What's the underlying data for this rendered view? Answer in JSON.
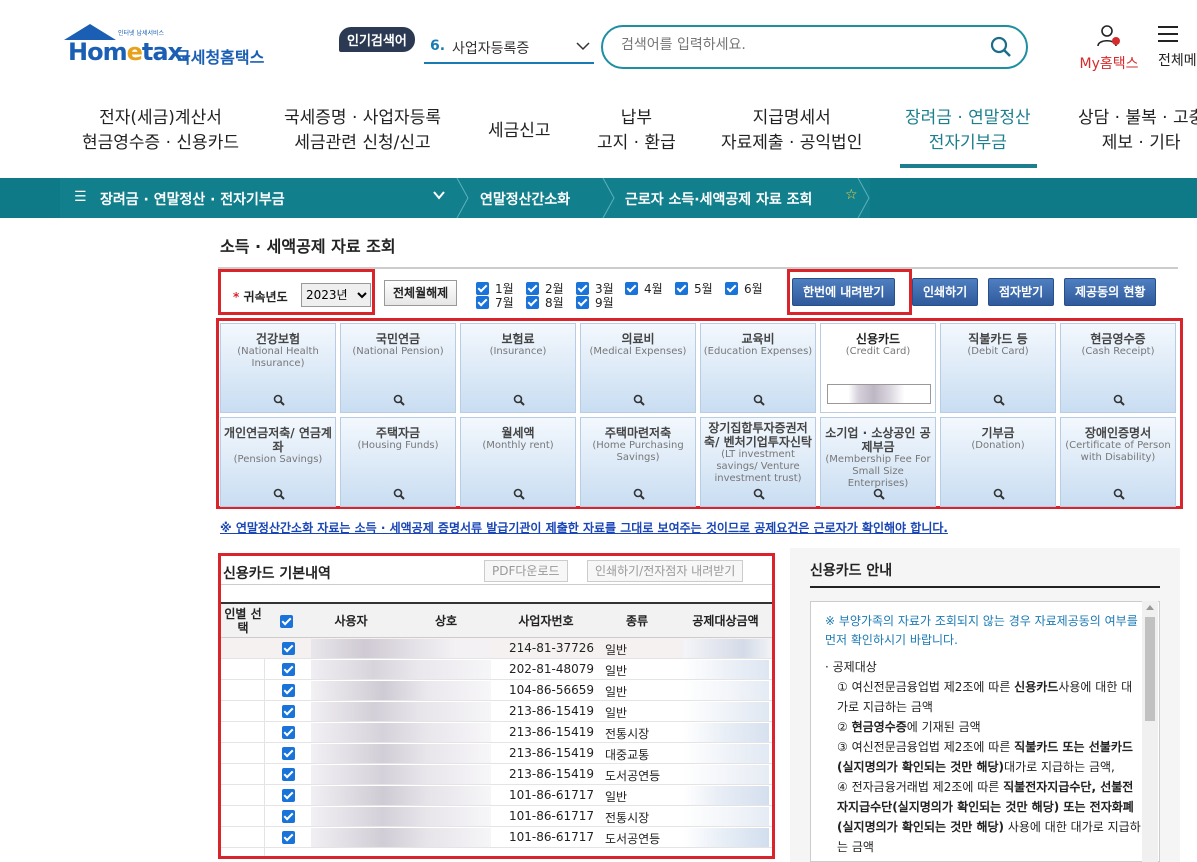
{
  "header": {
    "logo_small": "인터넷 납세서비스",
    "logo_main_1": "Hom",
    "logo_main_e": "e",
    "logo_main_2": "tax.",
    "logo_sub": "국세청홈택스",
    "popular_tag": "인기검색어",
    "popular_rank": "6.",
    "popular_item": "사업자등록증",
    "search_placeholder": "검색어를 입력하세요.",
    "my_hometax": "My홈택스",
    "all_menu": "전체메"
  },
  "nav": [
    {
      "line1": "전자(세금)계산서",
      "line2": "현금영수증 · 신용카드"
    },
    {
      "line1": "국세증명 · 사업자등록",
      "line2": "세금관련 신청/신고"
    },
    {
      "line1": "세금신고",
      "line2": ""
    },
    {
      "line1": "납부",
      "line2": "고지 · 환급"
    },
    {
      "line1": "지급명세서",
      "line2": "자료제출 · 공익법인"
    },
    {
      "line1": "장려금 · 연말정산",
      "line2": "전자기부금"
    },
    {
      "line1": "상담 · 불복 · 고충",
      "line2": "제보 · 기타"
    }
  ],
  "breadcrumb": {
    "menu": "장려금 · 연말정산 · 전자기부금",
    "level2": "연말정산간소화",
    "level3": "근로자 소득·세액공제 자료 조회"
  },
  "page_title": "소득 · 세액공제 자료 조회",
  "filter": {
    "year_label": "귀속년도",
    "year_value": "2023년",
    "btn_toggle_all": "전체월해제",
    "months": [
      "1월",
      "2월",
      "3월",
      "4월",
      "5월",
      "6월",
      "7월",
      "8월",
      "9월"
    ],
    "btn_download_all": "한번에 내려받기",
    "btn_print": "인쇄하기",
    "btn_braille": "점자받기",
    "btn_provider_status": "제공동의 현황"
  },
  "categories": [
    {
      "ko": "건강보험",
      "en": "(National Health Insurance)"
    },
    {
      "ko": "국민연금",
      "en": "(National Pension)"
    },
    {
      "ko": "보험료",
      "en": "(Insurance)"
    },
    {
      "ko": "의료비",
      "en": "(Medical Expenses)"
    },
    {
      "ko": "교육비",
      "en": "(Education Expenses)"
    },
    {
      "ko": "신용카드",
      "en": "(Credit Card)"
    },
    {
      "ko": "직불카드 등",
      "en": "(Debit Card)"
    },
    {
      "ko": "현금영수증",
      "en": "(Cash Receipt)"
    },
    {
      "ko": "개인연금저축/ 연금계좌",
      "en": "(Pension Savings)"
    },
    {
      "ko": "주택자금",
      "en": "(Housing Funds)"
    },
    {
      "ko": "월세액",
      "en": "(Monthly rent)"
    },
    {
      "ko": "주택마련저축",
      "en": "(Home Purchasing Savings)"
    },
    {
      "ko": "장기집합투자증권저축/ 벤처기업투자신탁",
      "en": "(LT investment savings/ Venture investment trust)"
    },
    {
      "ko": "소기업 · 소상공인 공제부금",
      "en": "(Membership Fee For Small Size Enterprises)"
    },
    {
      "ko": "기부금",
      "en": "(Donation)"
    },
    {
      "ko": "장애인증명서",
      "en": "(Certificate of Person with Disability)"
    }
  ],
  "notice": "※ 연말정산간소화 자료는 소득 · 세액공제 증명서류 발급기관이 제출한 자료를 그대로 보여주는 것이므로 공제요건은 근로자가 확인해야 합니다.",
  "card_list": {
    "title": "신용카드 기본내역",
    "btn_pdf": "PDF다운로드",
    "btn_print": "인쇄하기/전자점자 내려받기",
    "headers": {
      "person_select": "인별 선택",
      "user": "사용자",
      "store": "상호",
      "biz_no": "사업자번호",
      "type": "종류",
      "amount": "공제대상금액"
    },
    "rows": [
      {
        "biz_no": "214-81-37726",
        "type": "일반"
      },
      {
        "biz_no": "202-81-48079",
        "type": "일반"
      },
      {
        "biz_no": "104-86-56659",
        "type": "일반"
      },
      {
        "biz_no": "213-86-15419",
        "type": "일반"
      },
      {
        "biz_no": "213-86-15419",
        "type": "전통시장"
      },
      {
        "biz_no": "213-86-15419",
        "type": "대중교통"
      },
      {
        "biz_no": "213-86-15419",
        "type": "도서공연등"
      },
      {
        "biz_no": "101-86-61717",
        "type": "일반"
      },
      {
        "biz_no": "101-86-61717",
        "type": "전통시장"
      },
      {
        "biz_no": "101-86-61717",
        "type": "도서공연등"
      }
    ]
  },
  "guide": {
    "title": "신용카드 안내",
    "note": "※ 부양가족의 자료가 조회되지 않는 경우 자료제공동의 여부를 먼저 확인하시기 바랍니다.",
    "section": "공제대상",
    "items": [
      {
        "a": "① 여신전문금융업법 제2조에 따른 ",
        "b": "신용카드",
        "c": "사용에 대한 대가로 지급하는 금액"
      },
      {
        "a": "② ",
        "b": "현금영수증",
        "c": "에 기재된 금액"
      },
      {
        "a": "③ 여신전문금융업법 제2조에 따른 ",
        "b": "직불카드 또는 선불카드(실지명의가 확인되는 것만 해당)",
        "c": "대가로 지급하는 금액,"
      },
      {
        "a": "④ 전자금융거래법 제2조에 따른 ",
        "b": "직불전자지급수단, 선불전자지급수단(실지명의가 확인되는 것만 해당) 또는 전자화폐(실지명의가 확인되는 것만 해당)",
        "c": " 사용에 대한 대가로 지급하는 금액"
      }
    ]
  }
}
